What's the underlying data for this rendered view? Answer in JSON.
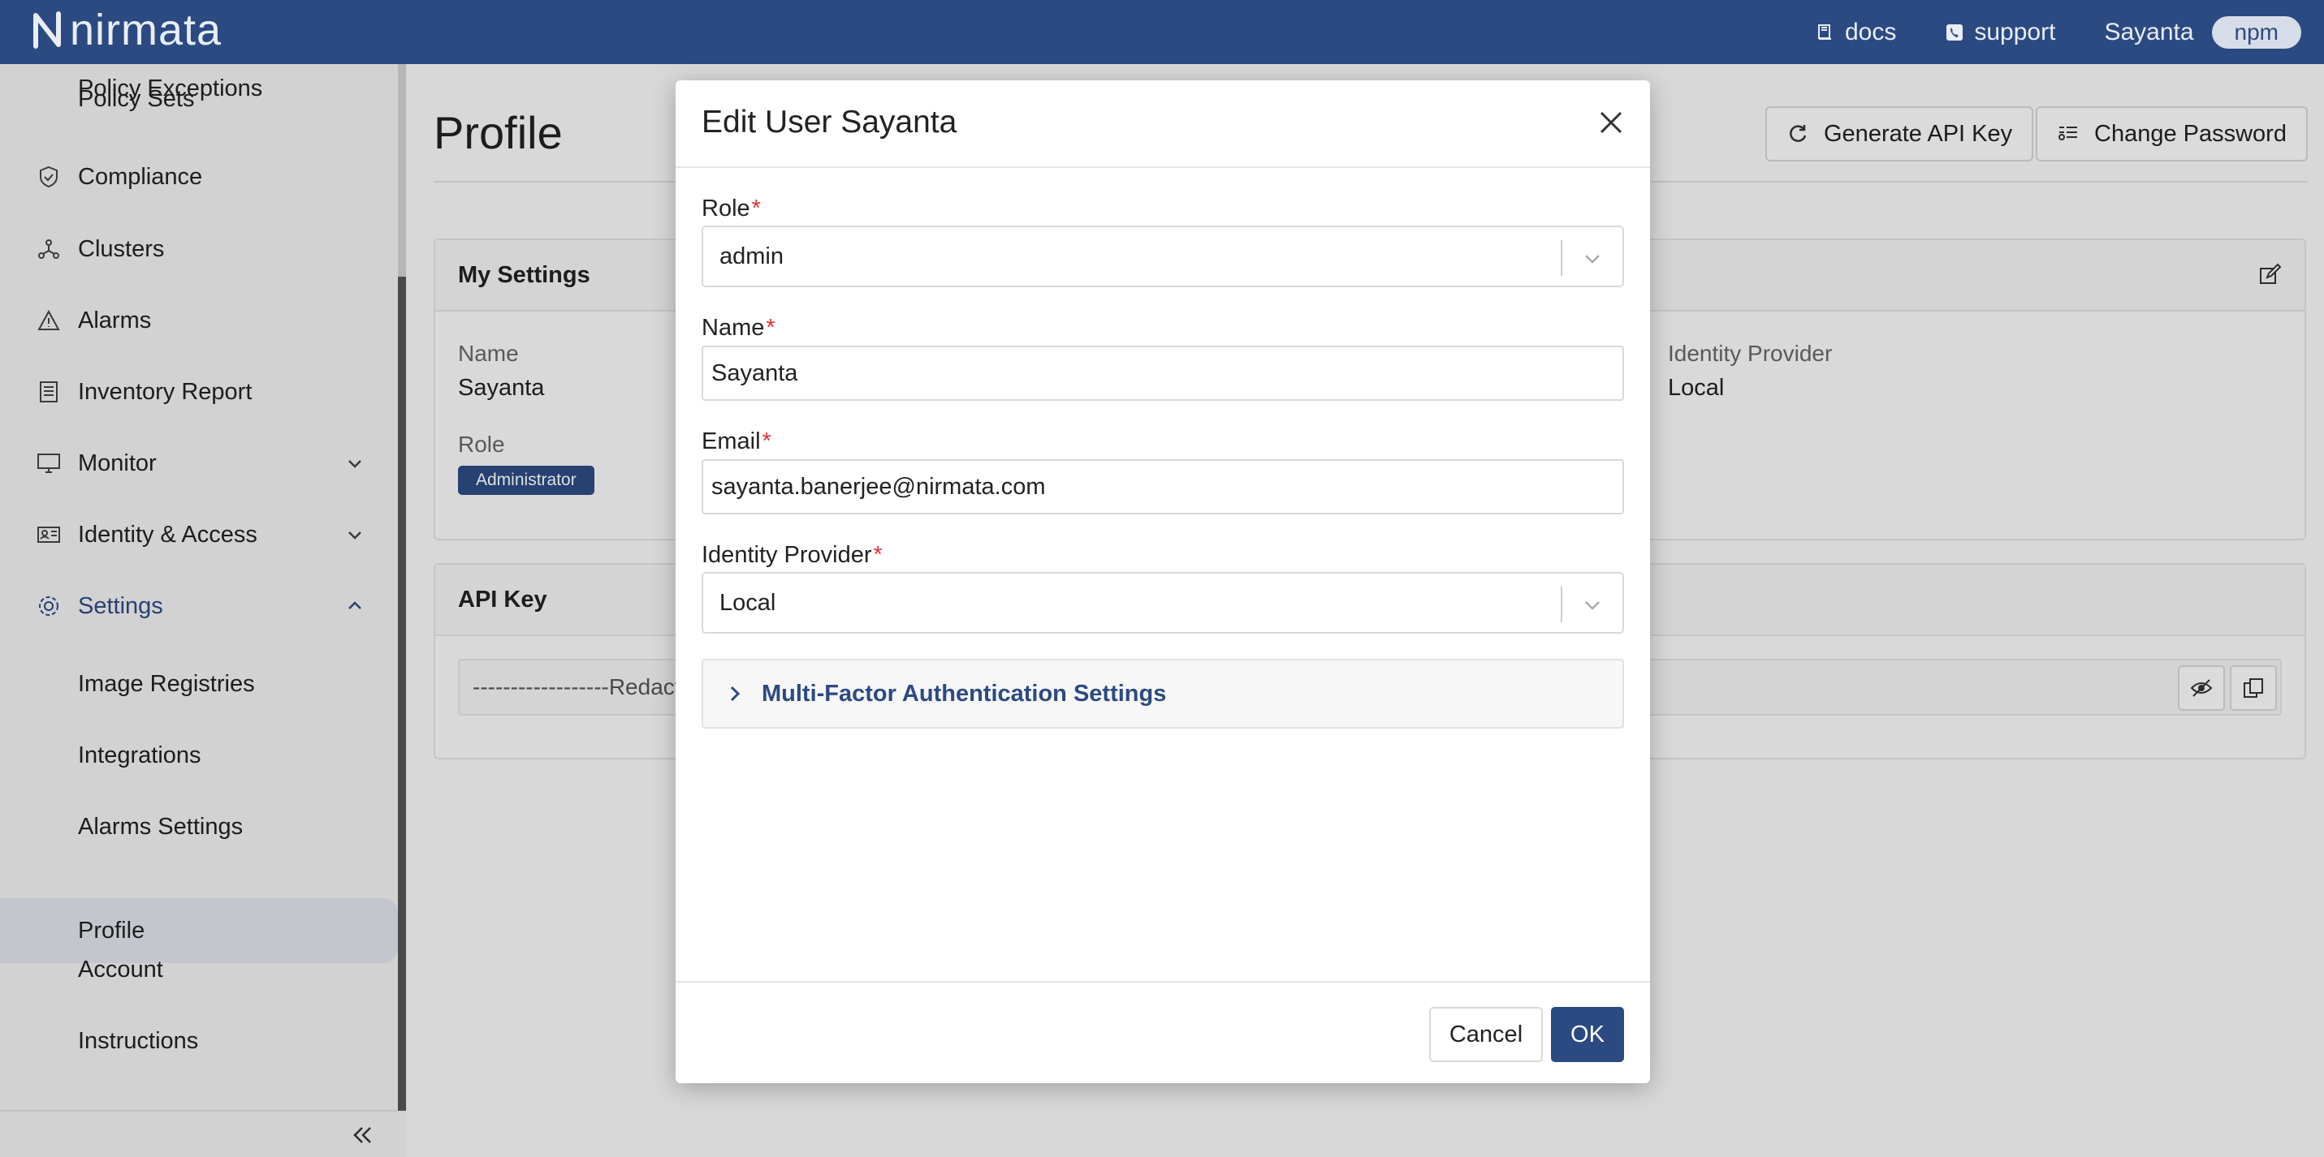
{
  "topbar": {
    "logo_text": "nirmata",
    "docs_label": "docs",
    "support_label": "support",
    "user_name": "Sayanta",
    "badge": "npm"
  },
  "sidebar": {
    "items": [
      {
        "label": "Policy Exceptions"
      },
      {
        "label": "Policy Sets"
      },
      {
        "label": "Compliance",
        "icon": "shield-check-icon"
      },
      {
        "label": "Clusters",
        "icon": "cluster-icon"
      },
      {
        "label": "Alarms",
        "icon": "warning-icon"
      },
      {
        "label": "Inventory Report",
        "icon": "report-icon"
      },
      {
        "label": "Monitor",
        "icon": "monitor-icon"
      },
      {
        "label": "Identity & Access",
        "icon": "id-card-icon"
      },
      {
        "label": "Settings",
        "icon": "gear-icon"
      },
      {
        "label": "Image Registries"
      },
      {
        "label": "Integrations"
      },
      {
        "label": "Alarms Settings"
      },
      {
        "label": "Profile"
      },
      {
        "label": "Account"
      },
      {
        "label": "Instructions"
      }
    ],
    "selected": "Profile",
    "accent_color": "#2c4a82"
  },
  "main": {
    "title": "Profile",
    "generate_api_key_label": "Generate API Key",
    "change_password_label": "Change Password",
    "my_settings": {
      "heading": "My Settings",
      "name_label": "Name",
      "name_value": "Sayanta",
      "role_label": "Role",
      "role_value": "Administrator",
      "idp_label": "Identity Provider",
      "idp_value": "Local"
    },
    "api_key": {
      "heading": "API Key",
      "value": "------------------Redact"
    }
  },
  "modal": {
    "title": "Edit User Sayanta",
    "role_label": "Role",
    "role_value": "admin",
    "name_label": "Name",
    "name_value": "Sayanta",
    "email_label": "Email",
    "email_value": "sayanta.banerjee@nirmata.com",
    "idp_label": "Identity Provider",
    "idp_value": "Local",
    "required_mark": "*",
    "mfa_label": "Multi-Factor Authentication Settings",
    "cancel_label": "Cancel",
    "ok_label": "OK"
  }
}
